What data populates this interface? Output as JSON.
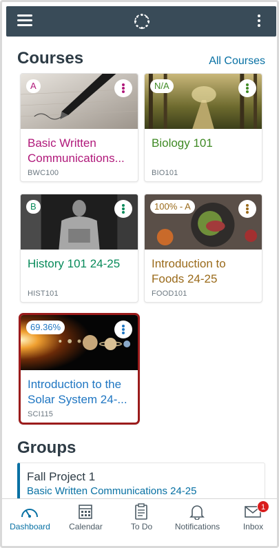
{
  "header": {
    "menu_icon": "hamburger-icon",
    "logo_icon": "canvas-logo-icon",
    "more_icon": "kebab-icon"
  },
  "courses_section": {
    "title": "Courses",
    "all_courses_label": "All Courses",
    "cards": [
      {
        "grade": "A",
        "title": "Basic Written Communications...",
        "code": "BWC100",
        "color": "#b0187a",
        "image": "fountain-pen-photo"
      },
      {
        "grade": "N/A",
        "title": "Biology 101",
        "code": "BIO101",
        "color": "#3f8a24",
        "image": "forest-road-photo"
      },
      {
        "grade": "B",
        "title": "History 101 24-25",
        "code": "HIST101",
        "color": "#078a5a",
        "image": "lincoln-memorial-photo"
      },
      {
        "grade": "100% - A",
        "title": "Introduction to Foods 24-25",
        "code": "FOOD101",
        "color": "#9a6a1a",
        "image": "food-platter-photo"
      },
      {
        "grade": "69.36%",
        "title": "Introduction to the Solar System  24-...",
        "code": "SCI115",
        "color": "#1f76c2",
        "image": "solar-system-photo"
      }
    ]
  },
  "groups_section": {
    "title": "Groups",
    "items": [
      {
        "name": "Fall Project 1",
        "course": "Basic Written Communications 24-25"
      }
    ]
  },
  "tabbar": {
    "tabs": [
      {
        "label": "Dashboard",
        "icon": "dashboard-icon",
        "active": true
      },
      {
        "label": "Calendar",
        "icon": "calendar-icon"
      },
      {
        "label": "To Do",
        "icon": "todo-icon"
      },
      {
        "label": "Notifications",
        "icon": "bell-icon"
      },
      {
        "label": "Inbox",
        "icon": "inbox-icon",
        "badge": "1"
      }
    ]
  }
}
